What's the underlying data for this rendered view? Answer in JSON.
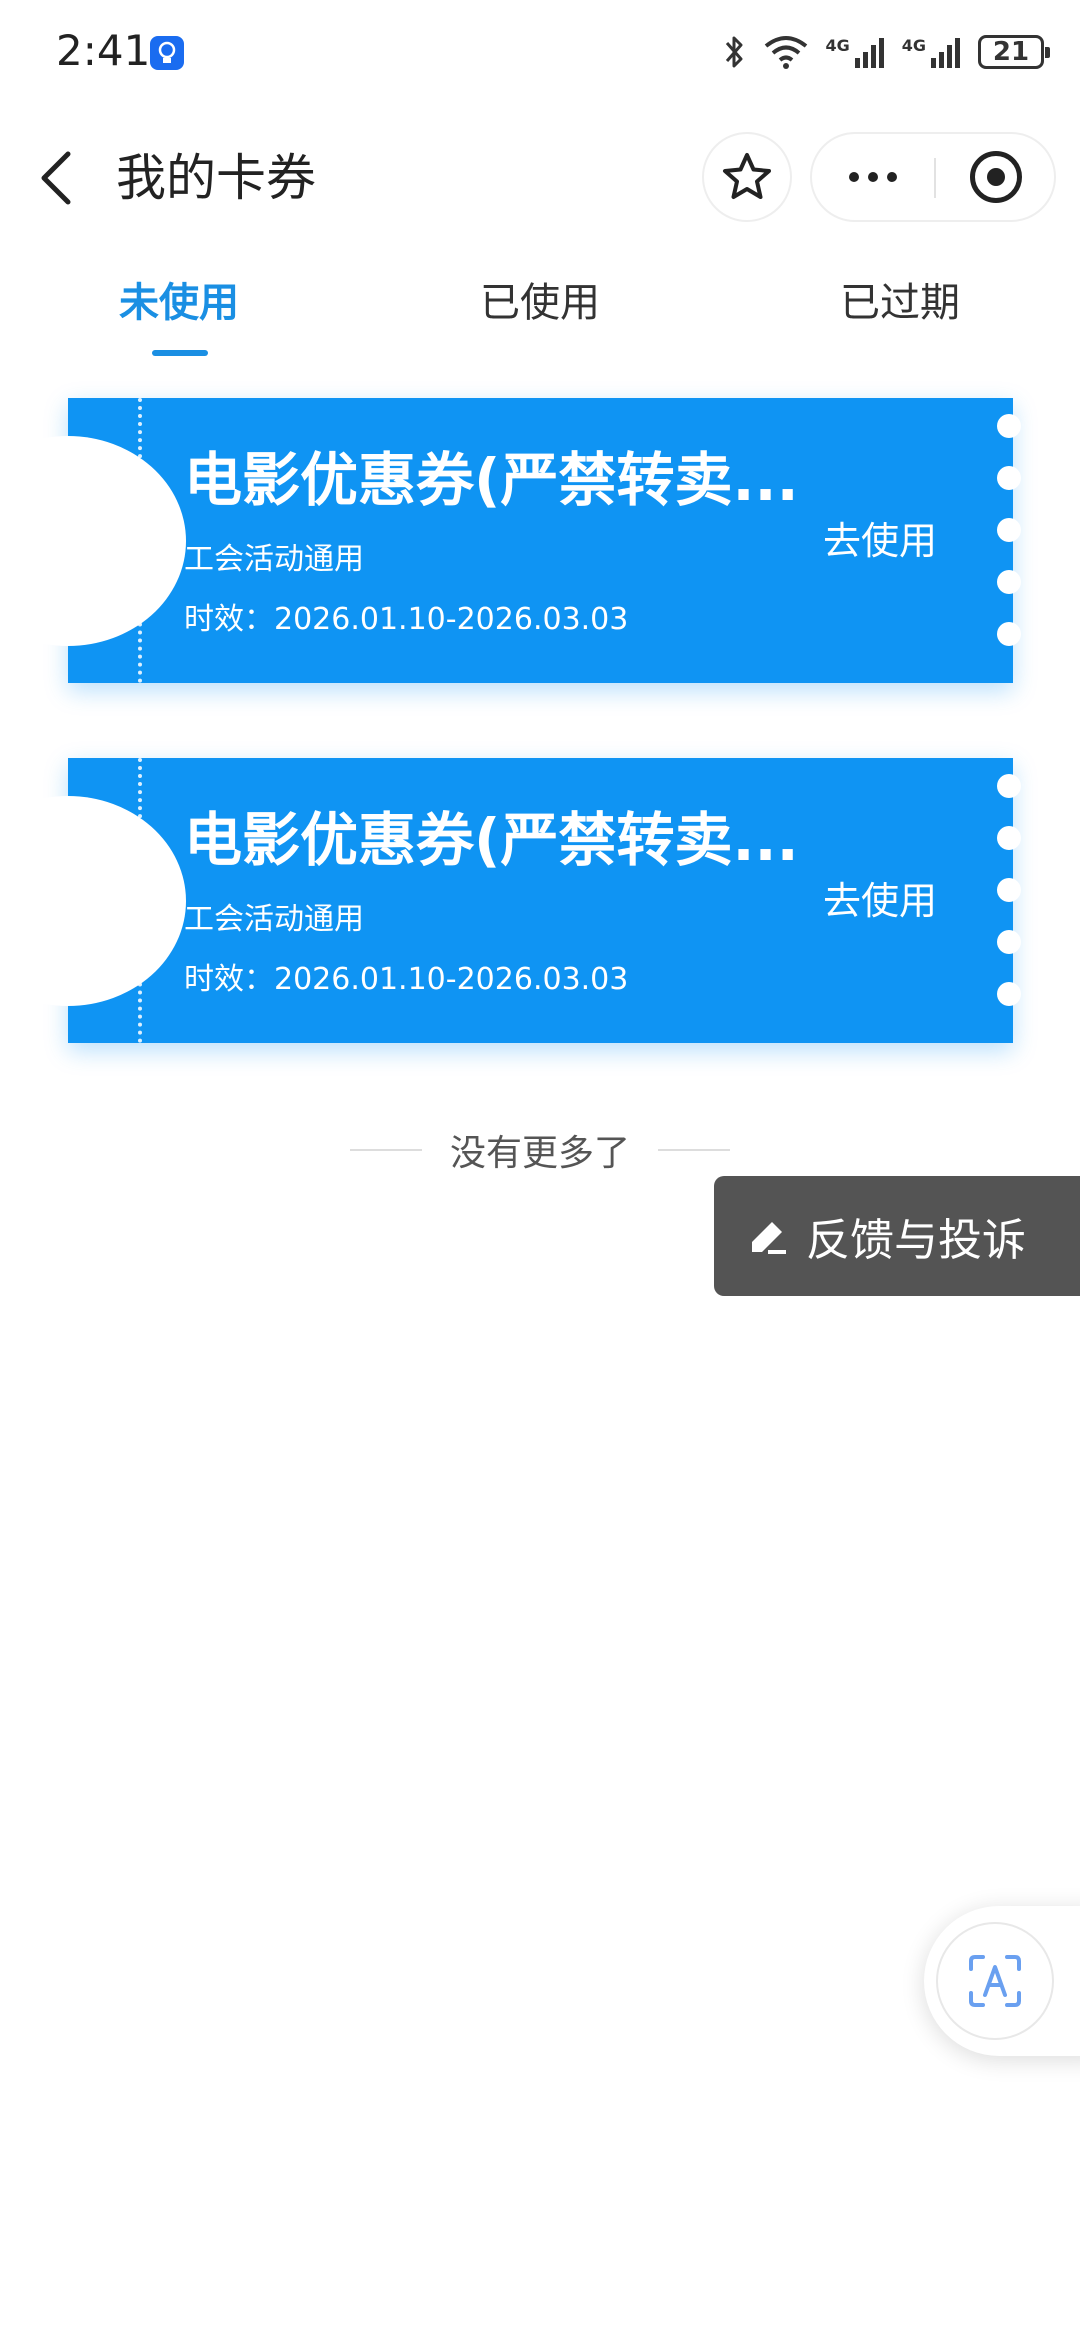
{
  "status_bar": {
    "time": "2:41",
    "network_label_1": "4G",
    "network_label_2": "4G",
    "battery_level": "21"
  },
  "nav": {
    "title": "我的卡券"
  },
  "tabs": [
    {
      "label": "未使用",
      "active": true
    },
    {
      "label": "已使用",
      "active": false
    },
    {
      "label": "已过期",
      "active": false
    }
  ],
  "coupons": [
    {
      "title": "电影优惠券(严禁转卖...",
      "subtitle": "工会活动通用",
      "validity": "时效：2026.01.10-2026.03.03",
      "action": "去使用"
    },
    {
      "title": "电影优惠券(严禁转卖...",
      "subtitle": "工会活动通用",
      "validity": "时效：2026.01.10-2026.03.03",
      "action": "去使用"
    }
  ],
  "end_hint": "没有更多了",
  "feedback": {
    "label": "反馈与投诉",
    "icon": "edit-pencil-icon"
  },
  "float_button": {
    "icon": "text-scan-icon"
  },
  "colors": {
    "accent": "#1a8fe3",
    "coupon": "#0f94f3",
    "feedback_bg": "#545454"
  }
}
